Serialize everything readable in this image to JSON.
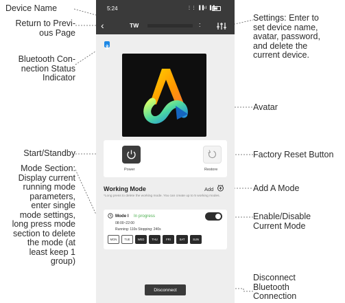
{
  "annotations": {
    "device_name": "Device Name",
    "return": "Return to Previ-\nous Page",
    "bluetooth_status": "Bluetooth Con-\nnection Status\nIndicator",
    "start_standby": "Start/Standby",
    "mode_section": "Mode Section:\nDisplay current\nrunning mode\nparameters,\nenter single\nmode settings,\nlong press mode\nsection to delete\nthe mode (at\nleast keep 1\ngroup)",
    "settings": "Settings: Enter to\nset device name,\navatar, password,\nand delete the\ncurrent device.",
    "avatar": "Avatar",
    "factory_reset": "Factory Reset Button",
    "add_mode": "Add A Mode",
    "enable_disable": "Enable/Disable\nCurrent Mode",
    "disconnect": "Disconnect\nBluetooth\nConnection"
  },
  "status_bar": {
    "time": "5:24",
    "signal": "⋮⋮ ▐▐ıl ▐▐ıl"
  },
  "top_bar": {
    "back_icon": "chevron-left-icon",
    "device_name": "TW",
    "colon": ":",
    "settings_icon": "sliders-icon"
  },
  "bluetooth": {
    "icon": "bluetooth-icon",
    "color": "#1e88e5"
  },
  "controls": {
    "power_label": "Power",
    "restore_label": "Restore"
  },
  "working_mode": {
    "title": "Working Mode",
    "add_label": "Add",
    "hint": "*Long press to delete the working mode. You can create up to 5 working modes."
  },
  "mode": {
    "name": "Mode I",
    "status": "In progress",
    "time_range": "08:00~22:00",
    "running_line": "Running:  110s  Stopping:  240s",
    "enabled": true,
    "days": [
      {
        "label": "MON",
        "on": false
      },
      {
        "label": "TUE",
        "on": false
      },
      {
        "label": "WED",
        "on": true
      },
      {
        "label": "THU",
        "on": true
      },
      {
        "label": "FRI",
        "on": true
      },
      {
        "label": "SAT",
        "on": true
      },
      {
        "label": "SUN",
        "on": true
      }
    ]
  },
  "disconnect_label": "Disconnect",
  "colors": {
    "accent_green": "#4caf50",
    "dark_bar": "#3a3a3a",
    "background": "#eeeeee"
  }
}
